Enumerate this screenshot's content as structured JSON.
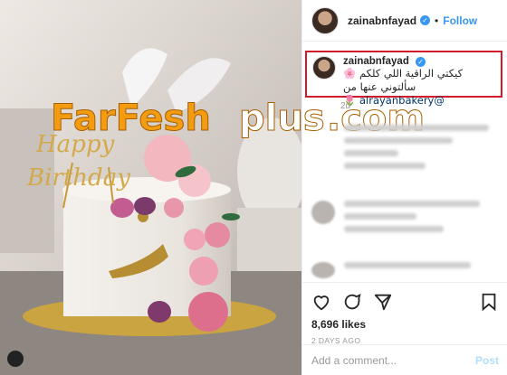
{
  "header": {
    "username": "zainabnfayad",
    "follow_label": "Follow",
    "dot": "•"
  },
  "caption": {
    "username": "zainabnfayad",
    "text_line1": "كيكتي الراقية اللي كلكم",
    "mention": "@alrayanbakery",
    "text_line2": "سألتوني عنها من",
    "emoji1": "🌸",
    "emoji2": "🌷"
  },
  "age": "2d",
  "watermark": {
    "part1": "FarFesh",
    "part2": "plus",
    "part3": ".com"
  },
  "cake_topper": {
    "line1": "Happy",
    "line2": "Birthday"
  },
  "likes": "8,696 likes",
  "date": "2 DAYS AGO",
  "comment_bar": {
    "placeholder": "Add a comment...",
    "post_label": "Post"
  },
  "colors": {
    "accent": "#3897f0",
    "highlight_box": "#d11a2a",
    "watermark_orange": "#f39c12"
  },
  "icons": [
    "heart-icon",
    "comment-icon",
    "share-icon",
    "bookmark-icon",
    "verified-badge-icon"
  ]
}
